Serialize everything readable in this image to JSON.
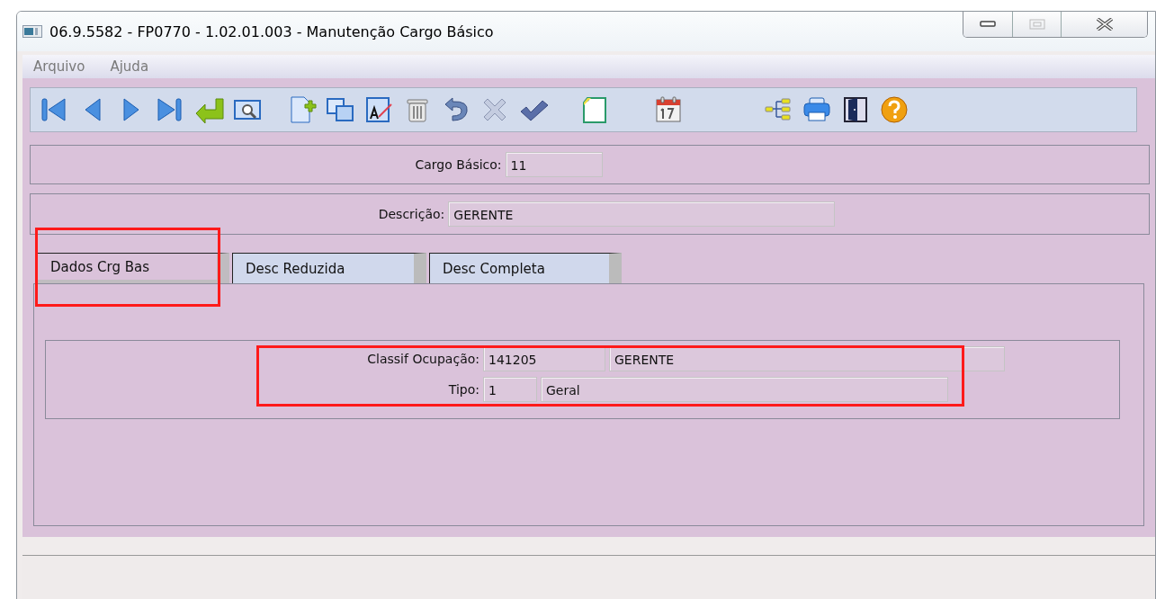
{
  "window": {
    "title": "06.9.5582 - FP0770 - 1.02.01.003 - Manutenção Cargo Básico"
  },
  "menu": [
    {
      "label": "Arquivo"
    },
    {
      "label": "Ajuda"
    }
  ],
  "header_fields": [
    {
      "label": "Cargo Básico:",
      "value": "11"
    },
    {
      "label": "Descrição:",
      "value": "GERENTE"
    }
  ],
  "tabs": [
    {
      "label": "Dados Crg Bas",
      "selected": true,
      "highlighted": true
    },
    {
      "label": "Desc Reduzida",
      "selected": false,
      "highlighted": false
    },
    {
      "label": "Desc Completa",
      "selected": false,
      "highlighted": false
    }
  ],
  "tab_panel": {
    "highlighted": true,
    "rows": [
      {
        "label": "Classif Ocupação:",
        "code": "141205",
        "description": "GERENTE"
      },
      {
        "label": "Tipo:",
        "code": "1",
        "description": "Geral"
      }
    ]
  }
}
